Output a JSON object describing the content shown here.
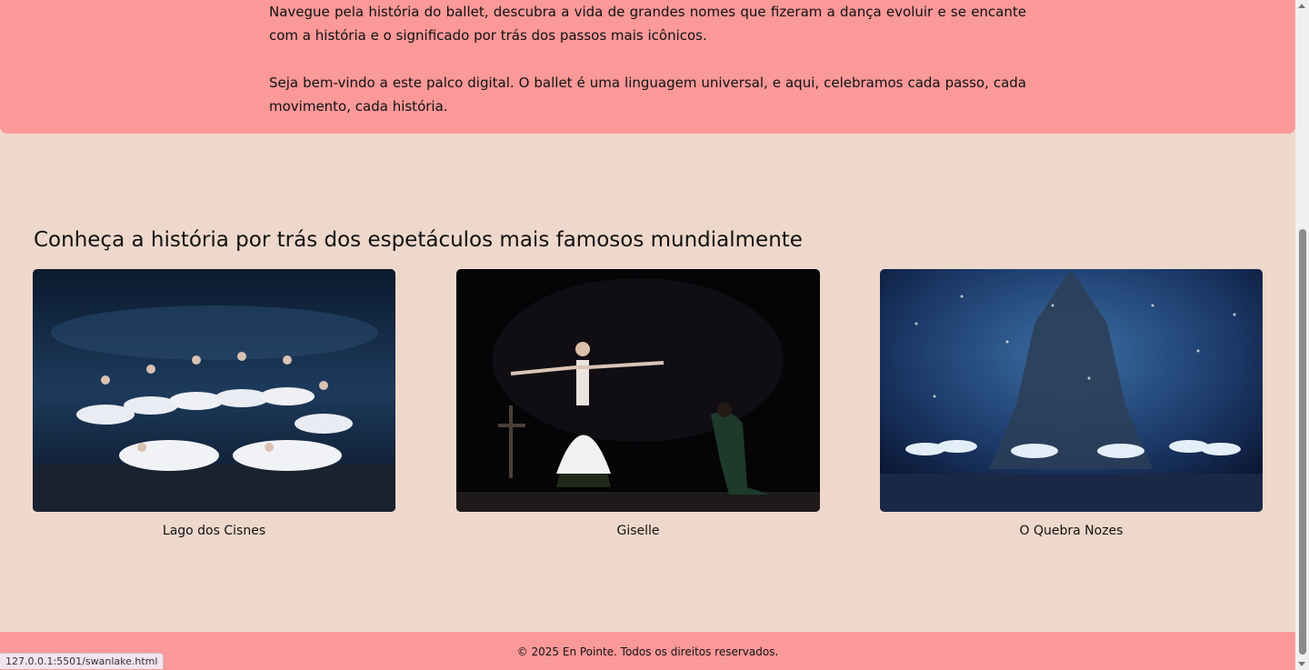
{
  "intro": {
    "paragraph1": "Navegue pela história do ballet, descubra a vida de grandes nomes que fizeram a dança evoluir e se encante com a história e o significado por trás dos passos mais icônicos.",
    "paragraph2": "Seja bem-vindo a este palco digital. O ballet é uma linguagem universal, e aqui, celebramos cada passo, cada movimento, cada história."
  },
  "section": {
    "title": "Conheça a história por trás dos espetáculos mais famosos mundialmente",
    "cards": [
      {
        "caption": "Lago dos Cisnes",
        "image": "swan-lake-photo"
      },
      {
        "caption": "Giselle",
        "image": "giselle-photo"
      },
      {
        "caption": "O Quebra Nozes",
        "image": "nutcracker-photo"
      }
    ]
  },
  "footer": {
    "text": "© 2025 En Pointe. Todos os direitos reservados."
  },
  "status_bar": {
    "url": "127.0.0.1:5501/swanlake.html"
  },
  "colors": {
    "background": "#eed8cc",
    "accent": "#fb9898"
  }
}
